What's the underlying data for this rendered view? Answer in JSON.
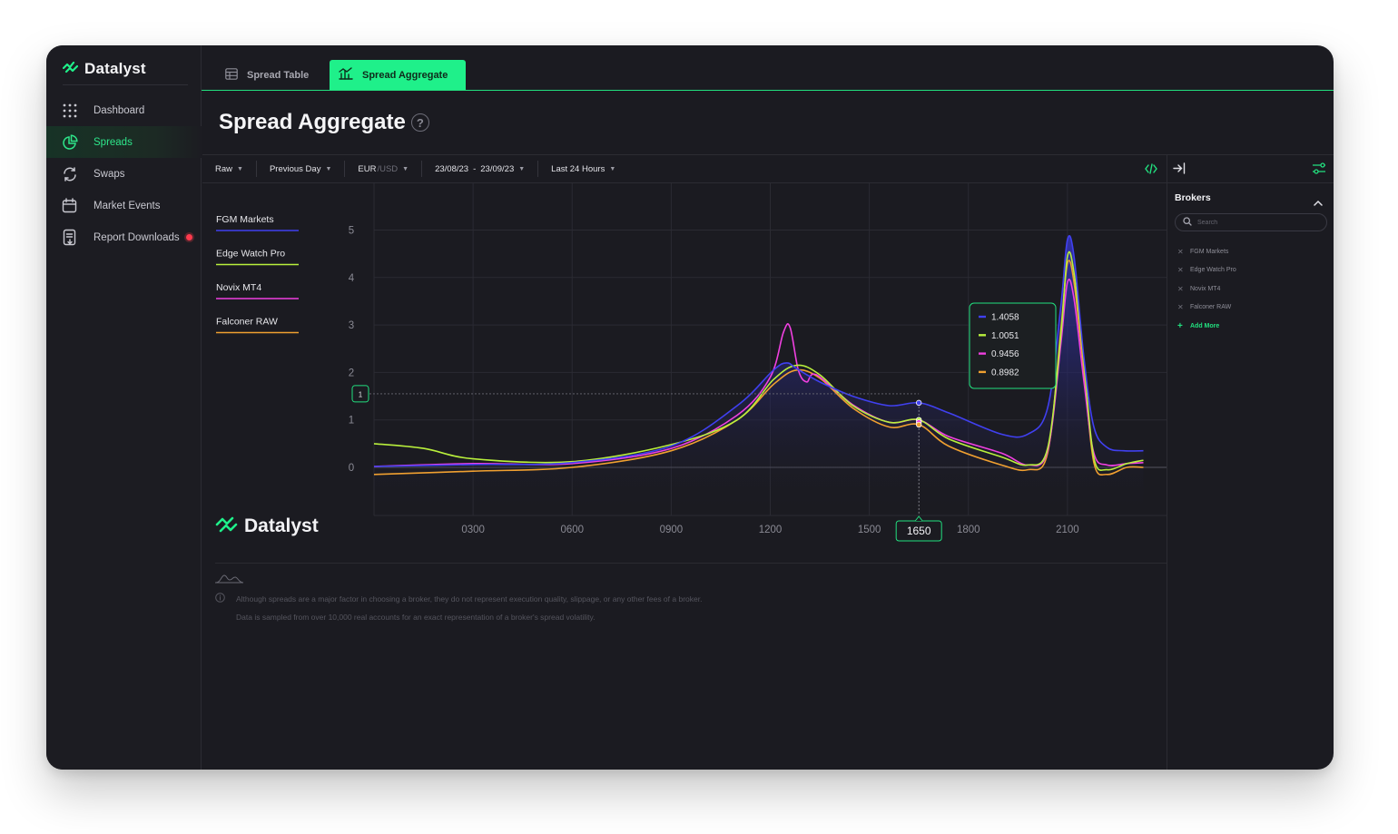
{
  "brand": {
    "name": "Datalyst",
    "accent": "#1ff08a"
  },
  "sidebar": {
    "items": [
      {
        "label": "Dashboard",
        "icon": "grid-dots-icon",
        "active": false
      },
      {
        "label": "Spreads",
        "icon": "pie-chart-icon",
        "active": true
      },
      {
        "label": "Swaps",
        "icon": "swap-arrows-icon",
        "active": false
      },
      {
        "label": "Market Events",
        "icon": "calendar-icon",
        "active": false
      },
      {
        "label": "Report Downloads",
        "icon": "report-icon",
        "active": false,
        "badge": true
      }
    ]
  },
  "tabs": [
    {
      "label": "Spread Table",
      "icon": "table-icon",
      "active": false
    },
    {
      "label": "Spread Aggregate",
      "icon": "chart-icon",
      "active": true
    }
  ],
  "page": {
    "title": "Spread Aggregate"
  },
  "toolbar": {
    "mode": "Raw",
    "period": "Previous Day",
    "pair_base": "EUR",
    "pair_quote": "/USD",
    "date_from": "23/08/23",
    "date_sep": "-",
    "date_to": "23/09/23",
    "window": "Last 24 Hours"
  },
  "panel": {
    "title": "Brokers",
    "search_placeholder": "Search",
    "brokers": [
      "FGM Markets",
      "Edge Watch Pro",
      "Novix MT4",
      "Falconer RAW"
    ],
    "add_label": "Add More"
  },
  "chart_data": {
    "type": "line",
    "x_ticks": [
      "0300",
      "0600",
      "0900",
      "1200",
      "1500",
      "1800",
      "2100"
    ],
    "y_ticks": [
      "0",
      "1",
      "2",
      "3",
      "4",
      "5"
    ],
    "ylim": [
      -1,
      6
    ],
    "watermark": "Datalyst",
    "crosshair": {
      "x_label": "1650",
      "y_label": "1"
    },
    "series": [
      {
        "name": "FGM Markets",
        "color": "#4040f0",
        "tooltip": "1.4058",
        "points": [
          [
            0,
            0.02
          ],
          [
            300,
            0.06
          ],
          [
            600,
            0.1
          ],
          [
            900,
            0.45
          ],
          [
            1100,
            1.3
          ],
          [
            1210,
            2.05
          ],
          [
            1250,
            2.2
          ],
          [
            1280,
            2.08
          ],
          [
            1350,
            1.8
          ],
          [
            1450,
            1.5
          ],
          [
            1560,
            1.3
          ],
          [
            1650,
            1.36
          ],
          [
            1740,
            1.15
          ],
          [
            1900,
            0.7
          ],
          [
            1980,
            0.7
          ],
          [
            2040,
            1.25
          ],
          [
            2080,
            3.4
          ],
          [
            2100,
            4.8
          ],
          [
            2120,
            4.45
          ],
          [
            2150,
            2.3
          ],
          [
            2180,
            0.85
          ],
          [
            2220,
            0.42
          ],
          [
            2270,
            0.35
          ],
          [
            2330,
            0.35
          ]
        ]
      },
      {
        "name": "Edge Watch Pro",
        "color": "#b9f03c",
        "tooltip": "1.0051",
        "points": [
          [
            0,
            0.5
          ],
          [
            150,
            0.4
          ],
          [
            300,
            0.18
          ],
          [
            600,
            0.12
          ],
          [
            900,
            0.48
          ],
          [
            1100,
            1.0
          ],
          [
            1210,
            1.85
          ],
          [
            1280,
            2.15
          ],
          [
            1350,
            1.95
          ],
          [
            1450,
            1.3
          ],
          [
            1560,
            0.95
          ],
          [
            1650,
            1.0
          ],
          [
            1740,
            0.6
          ],
          [
            1900,
            0.22
          ],
          [
            1980,
            0.05
          ],
          [
            2040,
            0.4
          ],
          [
            2080,
            2.8
          ],
          [
            2100,
            4.45
          ],
          [
            2120,
            4.1
          ],
          [
            2150,
            2.2
          ],
          [
            2180,
            0.2
          ],
          [
            2220,
            -0.05
          ],
          [
            2280,
            0.08
          ],
          [
            2330,
            0.15
          ]
        ]
      },
      {
        "name": "Novix MT4",
        "color": "#f040e0",
        "tooltip": "0.9456",
        "points": [
          [
            0,
            0.02
          ],
          [
            300,
            0.08
          ],
          [
            600,
            0.08
          ],
          [
            900,
            0.4
          ],
          [
            1100,
            1.1
          ],
          [
            1200,
            1.9
          ],
          [
            1240,
            2.85
          ],
          [
            1260,
            2.95
          ],
          [
            1285,
            2.05
          ],
          [
            1310,
            1.8
          ],
          [
            1340,
            1.95
          ],
          [
            1450,
            1.32
          ],
          [
            1560,
            0.95
          ],
          [
            1650,
            1.0
          ],
          [
            1740,
            0.65
          ],
          [
            1900,
            0.3
          ],
          [
            1980,
            0.05
          ],
          [
            2040,
            0.35
          ],
          [
            2080,
            2.6
          ],
          [
            2100,
            3.9
          ],
          [
            2120,
            3.55
          ],
          [
            2150,
            1.8
          ],
          [
            2180,
            0.3
          ],
          [
            2220,
            0.05
          ],
          [
            2280,
            0.08
          ],
          [
            2330,
            0.1
          ]
        ]
      },
      {
        "name": "Falconer RAW",
        "color": "#f0a030",
        "tooltip": "0.8982",
        "points": [
          [
            0,
            -0.15
          ],
          [
            300,
            -0.08
          ],
          [
            600,
            0.0
          ],
          [
            900,
            0.35
          ],
          [
            1100,
            1.0
          ],
          [
            1210,
            1.75
          ],
          [
            1280,
            2.05
          ],
          [
            1350,
            1.88
          ],
          [
            1450,
            1.25
          ],
          [
            1560,
            0.85
          ],
          [
            1650,
            0.9
          ],
          [
            1740,
            0.45
          ],
          [
            1900,
            0.05
          ],
          [
            1980,
            -0.05
          ],
          [
            2040,
            0.3
          ],
          [
            2080,
            2.9
          ],
          [
            2100,
            4.3
          ],
          [
            2120,
            3.9
          ],
          [
            2150,
            2.0
          ],
          [
            2180,
            0.1
          ],
          [
            2220,
            -0.15
          ],
          [
            2280,
            0.0
          ],
          [
            2330,
            0.0
          ]
        ]
      }
    ]
  },
  "disclaimer": {
    "line1": "Although spreads are a major factor in choosing a broker, they do not represent execution quality, slippage, or any other fees of a broker.",
    "line2": "Data is sampled from over 10,000 real accounts for an exact representation of a broker's spread volatility."
  }
}
